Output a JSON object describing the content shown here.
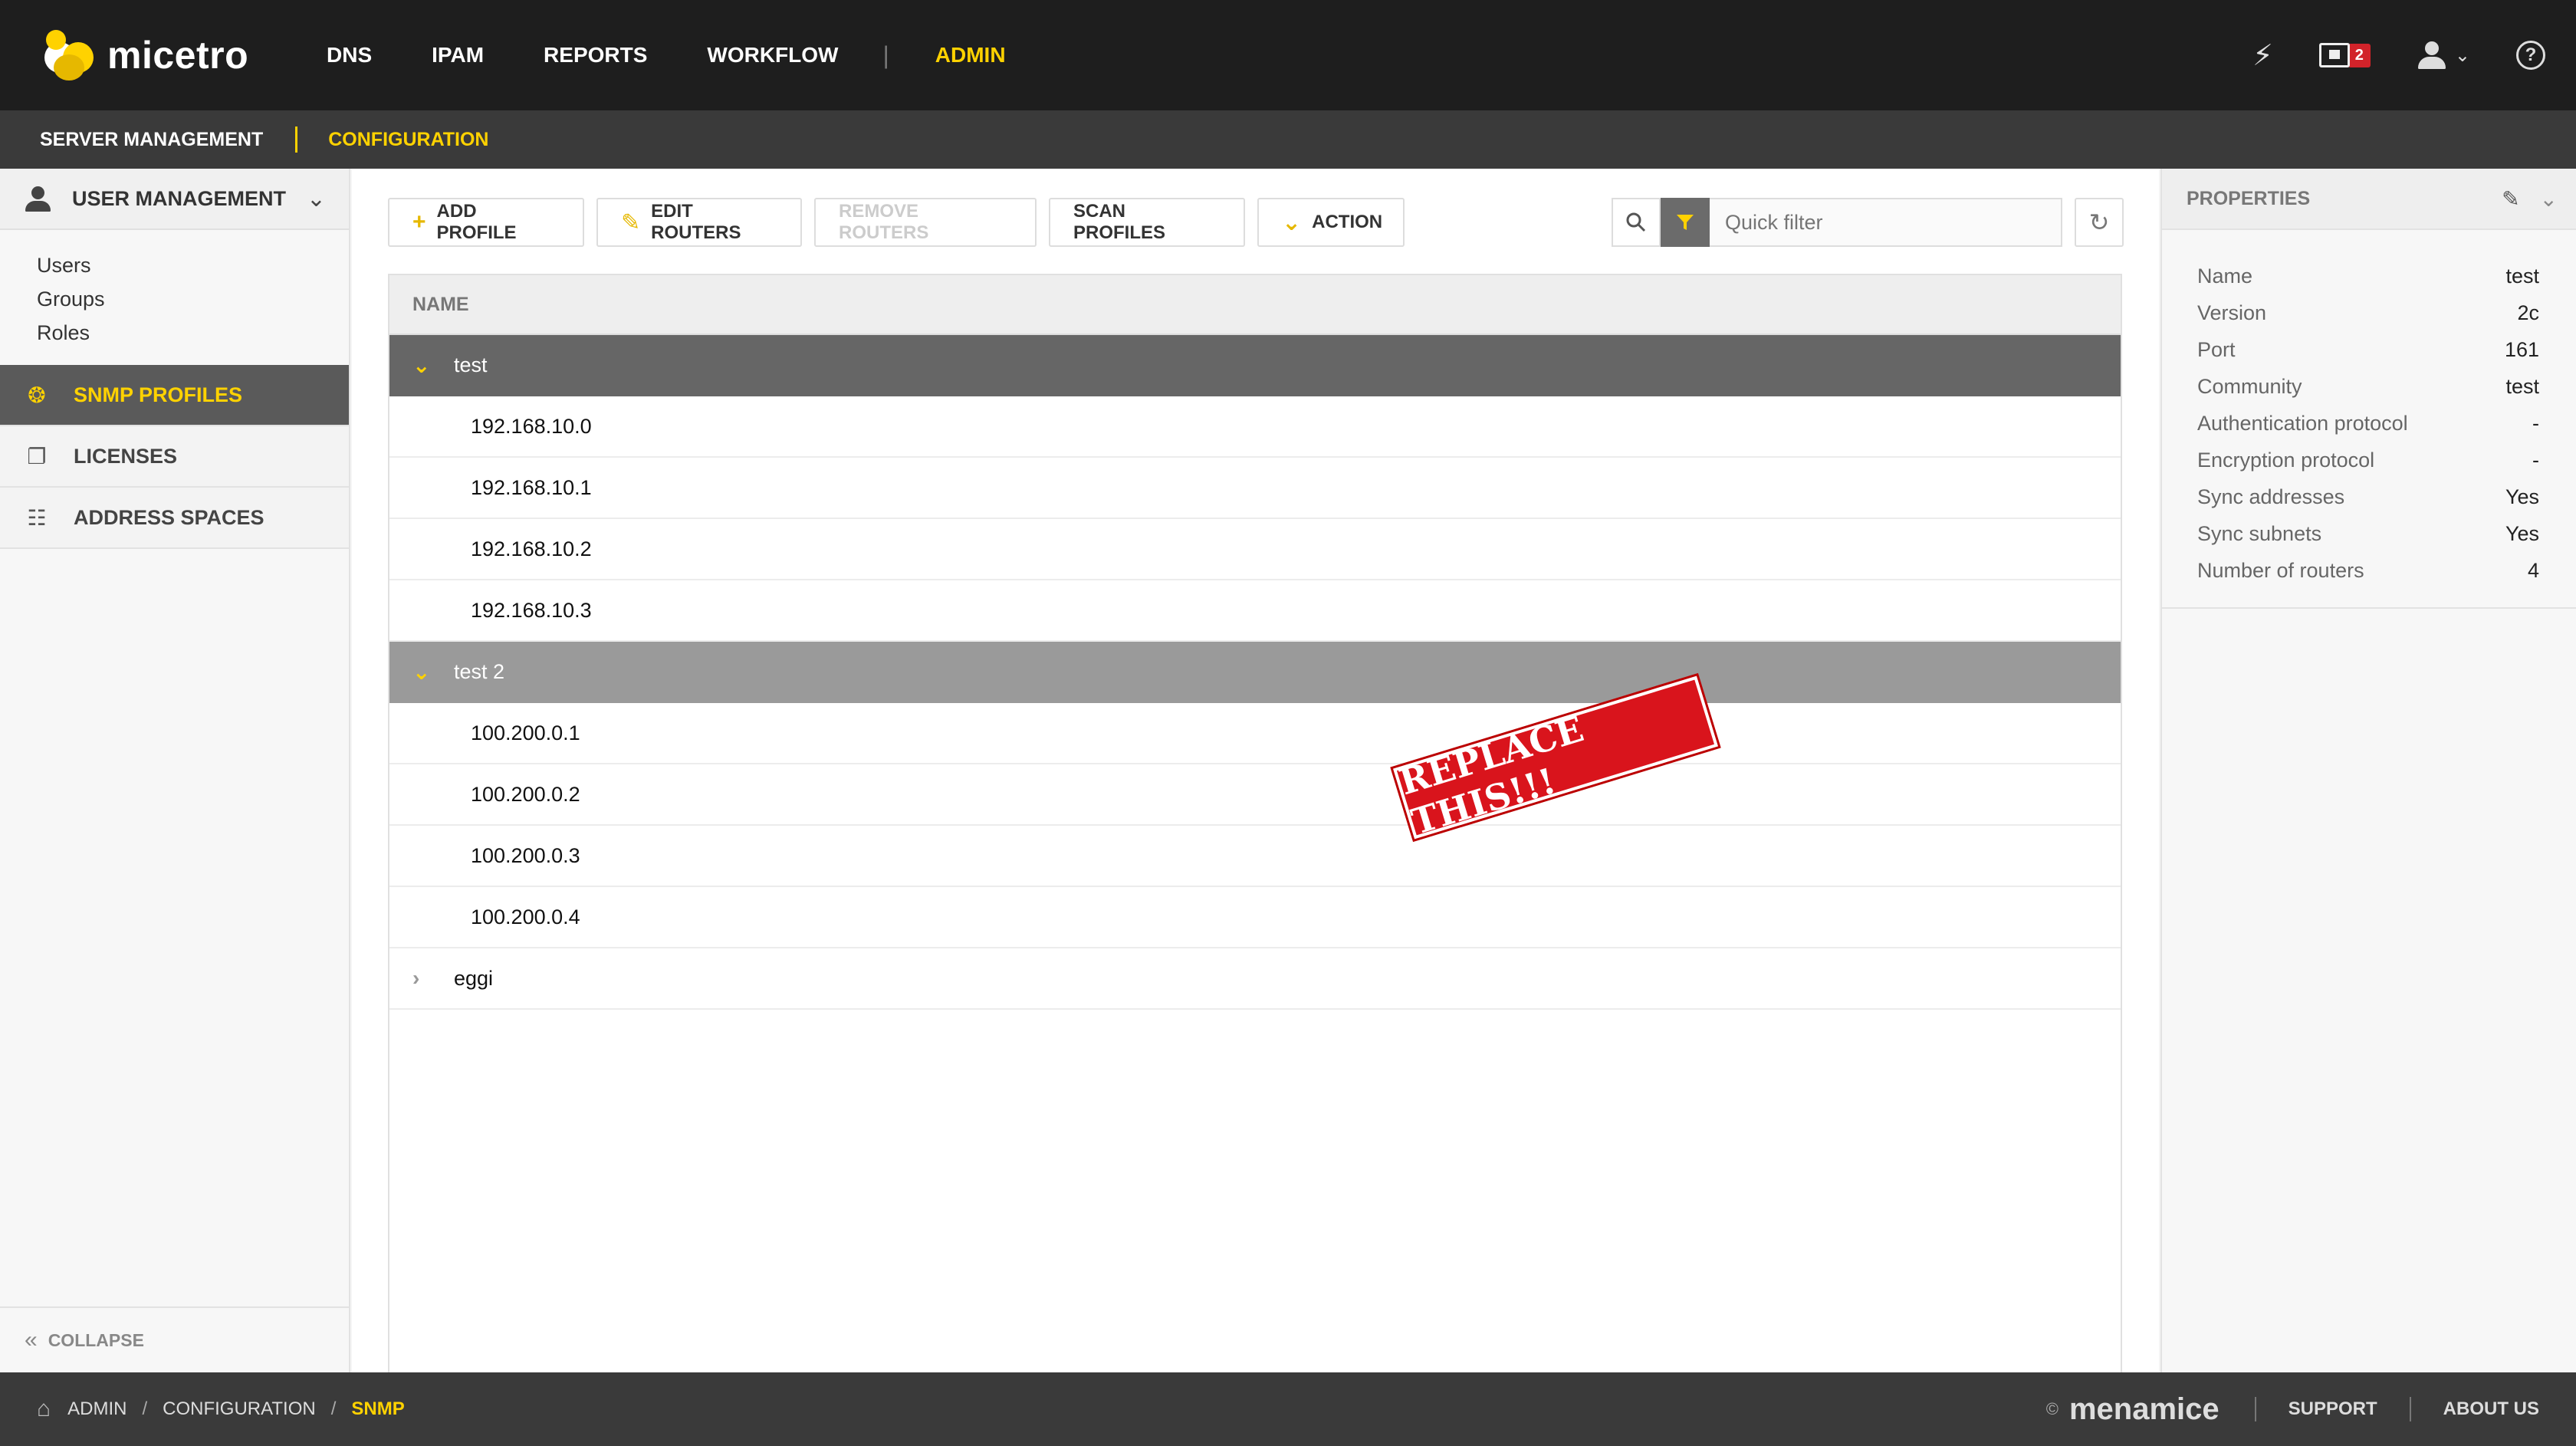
{
  "app": {
    "name": "micetro"
  },
  "topnav": {
    "items": [
      "DNS",
      "IPAM",
      "REPORTS",
      "WORKFLOW"
    ],
    "active": "ADMIN",
    "notification_count": "2",
    "help_label": "?"
  },
  "subnav": {
    "items": [
      "SERVER MANAGEMENT"
    ],
    "active": "CONFIGURATION"
  },
  "sidebar": {
    "user_management": "USER MANAGEMENT",
    "links": [
      "Users",
      "Groups",
      "Roles"
    ],
    "items": [
      "SNMP PROFILES",
      "LICENSES",
      "ADDRESS SPACES"
    ],
    "active_index": 0,
    "collapse": "COLLAPSE"
  },
  "toolbar": {
    "add": "ADD PROFILE",
    "edit": "EDIT ROUTERS",
    "remove": "REMOVE ROUTERS",
    "scan": "SCAN PROFILES",
    "action": "ACTION"
  },
  "search": {
    "placeholder": "Quick filter"
  },
  "grid": {
    "column": "NAME",
    "groups": [
      {
        "name": "test",
        "expanded": true,
        "children": [
          "192.168.10.0",
          "192.168.10.1",
          "192.168.10.2",
          "192.168.10.3"
        ]
      },
      {
        "name": "test 2",
        "expanded": true,
        "children": [
          "100.200.0.1",
          "100.200.0.2",
          "100.200.0.3",
          "100.200.0.4"
        ]
      },
      {
        "name": "eggi",
        "expanded": false,
        "children": []
      }
    ]
  },
  "stamp": "REPLACE THIS!!!",
  "properties": {
    "title": "PROPERTIES",
    "rows": [
      {
        "k": "Name",
        "v": "test"
      },
      {
        "k": "Version",
        "v": "2c"
      },
      {
        "k": "Port",
        "v": "161"
      },
      {
        "k": "Community",
        "v": "test"
      },
      {
        "k": "Authentication protocol",
        "v": "-"
      },
      {
        "k": "Encryption protocol",
        "v": "-"
      },
      {
        "k": "Sync addresses",
        "v": "Yes"
      },
      {
        "k": "Sync subnets",
        "v": "Yes"
      },
      {
        "k": "Number of routers",
        "v": "4"
      }
    ]
  },
  "footer": {
    "breadcrumb": [
      "ADMIN",
      "CONFIGURATION"
    ],
    "current": "SNMP",
    "copyright": "©",
    "brand": "menamice",
    "links": [
      "SUPPORT",
      "ABOUT US"
    ]
  }
}
